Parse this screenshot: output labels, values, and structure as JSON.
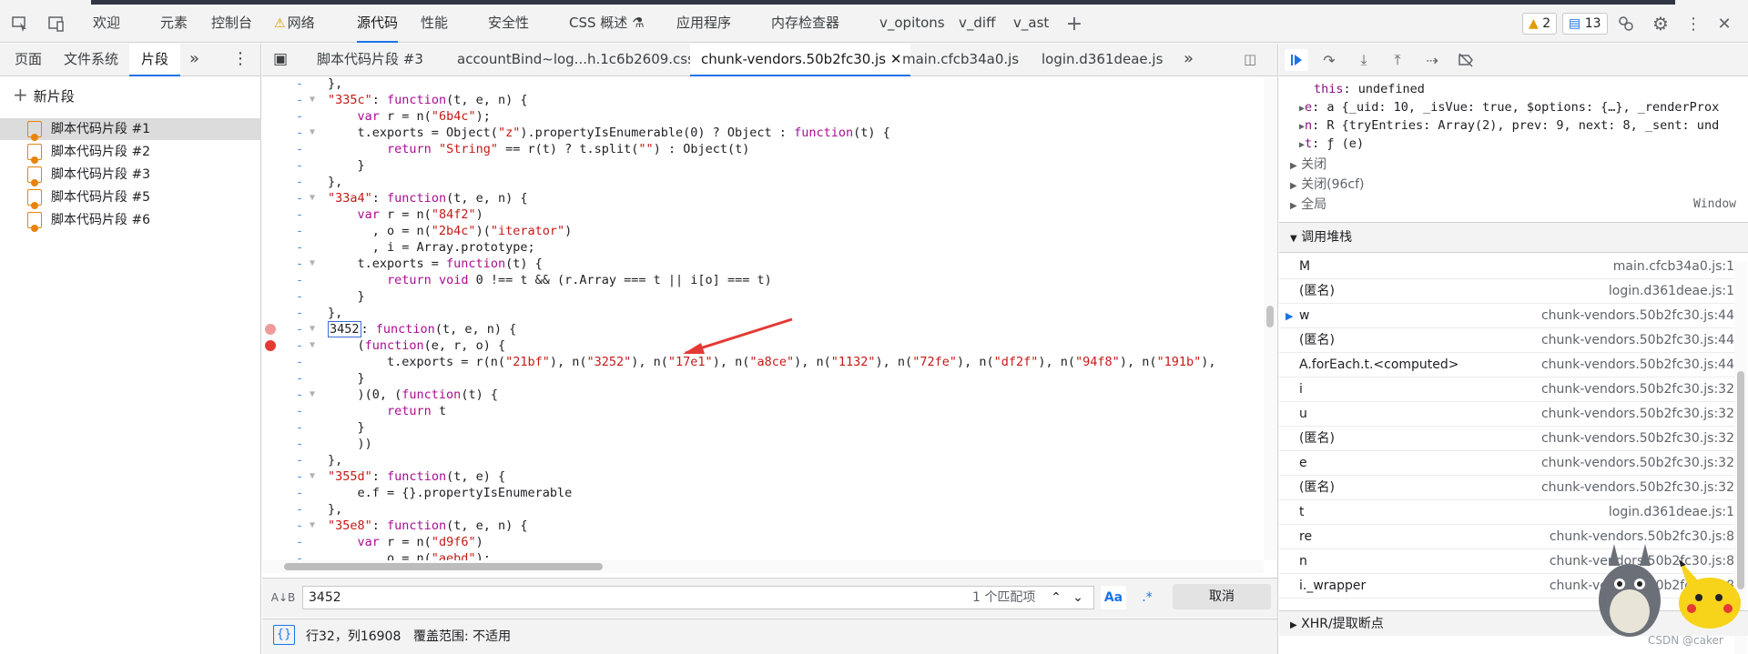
{
  "toolbar": {
    "tabs": [
      "欢迎",
      "元素",
      "控制台",
      "网络",
      "源代码",
      "性能",
      "安全性",
      "CSS 概述",
      "应用程序",
      "内存检查器",
      "v_opitons",
      "v_diff",
      "v_ast"
    ],
    "warning_count": "2",
    "message_count": "13"
  },
  "navigator": {
    "tabs": [
      "页面",
      "文件系统",
      "片段"
    ],
    "new_snippet_label": "新片段",
    "snippets": [
      "脚本代码片段 #1",
      "脚本代码片段 #2",
      "脚本代码片段 #3",
      "脚本代码片段 #5",
      "脚本代码片段 #6"
    ]
  },
  "editor": {
    "tabs": [
      "脚本代码片段 #3",
      "accountBind~log...h.1c6b2609.css",
      "chunk-vendors.50b2fc30.js",
      "main.cfcb34a0.js",
      "login.d361deae.js"
    ],
    "code_lines": [
      "},",
      "\"335c\": function(t, e, n) {",
      "    var r = n(\"6b4c\");",
      "    t.exports = Object(\"z\").propertyIsEnumerable(0) ? Object : function(t) {",
      "        return \"String\" == r(t) ? t.split(\"\") : Object(t)",
      "    }",
      "},",
      "\"33a4\": function(t, e, n) {",
      "    var r = n(\"84f2\")",
      "      , o = n(\"2b4c\")(\"iterator\")",
      "      , i = Array.prototype;",
      "    t.exports = function(t) {",
      "        return void 0 !== t && (r.Array === t || i[o] === t)",
      "    }",
      "},",
      "3452: function(t, e, n) {",
      "    (function(e, r, o) {",
      "        t.exports = r(n(\"21bf\"), n(\"3252\"), n(\"17e1\"), n(\"a8ce\"), n(\"1132\"), n(\"72fe\"), n(\"df2f\"), n(\"94f8\"), n(\"191b\"),",
      "    }",
      "    )(0, (function(t) {",
      "        return t",
      "    }",
      "    ))",
      "},",
      "\"355d\": function(t, e) {",
      "    e.f = {}.propertyIsEnumerable",
      "},",
      "\"35e8\": function(t, e, n) {",
      "    var r = n(\"d9f6\")",
      "      , o = n(\"aebd\");"
    ],
    "search": {
      "value": "3452",
      "match_count": "1 个匹配项",
      "case_label": "Aa",
      "regex_label": ".*",
      "cancel_label": "取消"
    },
    "status": {
      "position": "行32，列16908",
      "coverage": "覆盖范围: 不适用"
    }
  },
  "debugger": {
    "scope_lines": [
      {
        "key": "this",
        "val": ": undefined"
      },
      {
        "key": "e",
        "val": ": a {_uid: 10, _isVue: true, $options: {…}, _renderProx"
      },
      {
        "key": "n",
        "val": ": R {tryEntries: Array(2), prev: 9, next: 8, _sent: und"
      },
      {
        "key": "t",
        "val": ": ƒ (e)"
      }
    ],
    "closures": [
      "关闭",
      "关闭(96cf)",
      "全局"
    ],
    "global_value": "Window",
    "callstack_title": "调用堆栈",
    "callstack": [
      {
        "name": "M",
        "loc": "main.cfcb34a0.js:1"
      },
      {
        "name": "(匿名)",
        "loc": "login.d361deae.js:1"
      },
      {
        "name": "w",
        "loc": "chunk-vendors.50b2fc30.js:44"
      },
      {
        "name": "(匿名)",
        "loc": "chunk-vendors.50b2fc30.js:44"
      },
      {
        "name": "A.forEach.t.<computed>",
        "loc": "chunk-vendors.50b2fc30.js:44"
      },
      {
        "name": "i",
        "loc": "chunk-vendors.50b2fc30.js:32"
      },
      {
        "name": "u",
        "loc": "chunk-vendors.50b2fc30.js:32"
      },
      {
        "name": "(匿名)",
        "loc": "chunk-vendors.50b2fc30.js:32"
      },
      {
        "name": "e",
        "loc": "chunk-vendors.50b2fc30.js:32"
      },
      {
        "name": "(匿名)",
        "loc": "chunk-vendors.50b2fc30.js:32"
      },
      {
        "name": "t",
        "loc": "login.d361deae.js:1"
      },
      {
        "name": "re",
        "loc": "chunk-vendors.50b2fc30.js:8"
      },
      {
        "name": "n",
        "loc": "chunk-vendors.50b2fc30.js:8"
      },
      {
        "name": "i._wrapper",
        "loc": "chunk-vendors.50b2fc30.js:8"
      }
    ],
    "xhr_label": "XHR/提取断点"
  },
  "watermark": "CSDN @caker",
  "colors": {
    "accent": "#1a73e8",
    "breakpoint": "#e53935",
    "breakpoint_soft": "#ef9a9a",
    "arrow": "#e53935"
  }
}
